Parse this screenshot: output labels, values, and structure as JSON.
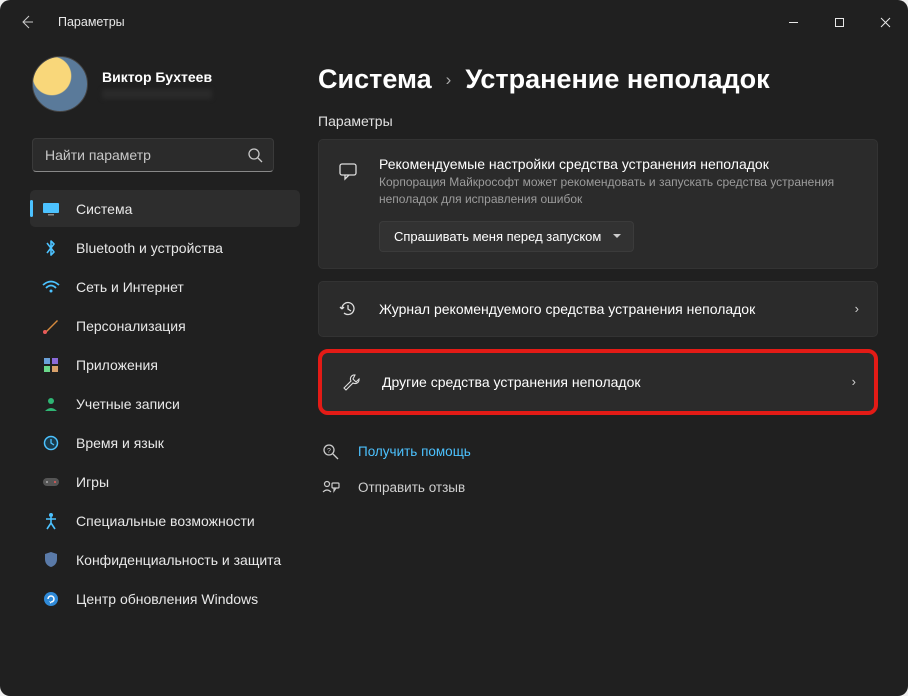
{
  "window": {
    "title": "Параметры"
  },
  "profile": {
    "name": "Виктор Бухтеев"
  },
  "search": {
    "placeholder": "Найти параметр"
  },
  "nav": {
    "items": [
      {
        "label": "Система",
        "icon": "system",
        "active": true
      },
      {
        "label": "Bluetooth и устройства",
        "icon": "bluetooth"
      },
      {
        "label": "Сеть и Интернет",
        "icon": "wifi"
      },
      {
        "label": "Персонализация",
        "icon": "personalize"
      },
      {
        "label": "Приложения",
        "icon": "apps"
      },
      {
        "label": "Учетные записи",
        "icon": "accounts"
      },
      {
        "label": "Время и язык",
        "icon": "time"
      },
      {
        "label": "Игры",
        "icon": "games"
      },
      {
        "label": "Специальные возможности",
        "icon": "accessibility"
      },
      {
        "label": "Конфиденциальность и защита",
        "icon": "privacy"
      },
      {
        "label": "Центр обновления Windows",
        "icon": "update"
      }
    ]
  },
  "breadcrumb": {
    "parent": "Система",
    "current": "Устранение неполадок"
  },
  "section_label": "Параметры",
  "cards": {
    "recommended": {
      "title": "Рекомендуемые настройки средства устранения неполадок",
      "sub": "Корпорация Майкрософт может рекомендовать и запускать средства устранения неполадок для исправления ошибок",
      "dropdown": "Спрашивать меня перед запуском"
    },
    "history": {
      "label": "Журнал рекомендуемого средства устранения неполадок"
    },
    "other": {
      "label": "Другие средства устранения неполадок"
    }
  },
  "footer": {
    "help": "Получить помощь",
    "feedback": "Отправить отзыв"
  }
}
